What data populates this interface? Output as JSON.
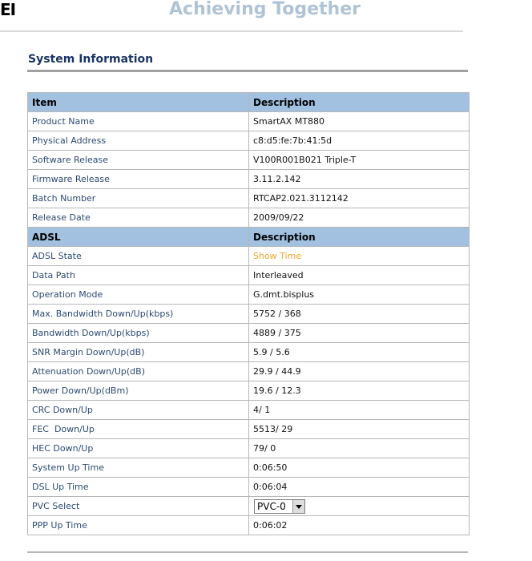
{
  "header": {
    "brand": "EI",
    "slogan": "Achieving Together"
  },
  "section": {
    "title": "System Information"
  },
  "system_table": {
    "header_item": "Item",
    "header_description": "Description",
    "rows": [
      {
        "label": "Product Name",
        "value": "SmartAX MT880"
      },
      {
        "label": "Physical Address",
        "value": "c8:d5:fe:7b:41:5d"
      },
      {
        "label": "Software Release",
        "value": "V100R001B021 Triple-T"
      },
      {
        "label": "Firmware Release",
        "value": "3.11.2.142"
      },
      {
        "label": "Batch Number",
        "value": "RTCAP2.021.3112142"
      },
      {
        "label": "Release Date",
        "value": "2009/09/22"
      }
    ]
  },
  "adsl_table": {
    "header_item": "ADSL",
    "header_description": "Description",
    "rows": [
      {
        "label": "ADSL State",
        "value": "Show Time"
      },
      {
        "label": "Data Path",
        "value": "Interleaved"
      },
      {
        "label": "Operation Mode",
        "value": "G.dmt.bisplus"
      },
      {
        "label": "Max. Bandwidth Down/Up(kbps)",
        "value": "5752 / 368"
      },
      {
        "label": "Bandwidth Down/Up(kbps)",
        "value": "4889 / 375"
      },
      {
        "label": "SNR Margin Down/Up(dB)",
        "value": "5.9 / 5.6"
      },
      {
        "label": "Attenuation Down/Up(dB)",
        "value": "29.9 / 44.9"
      },
      {
        "label": "Power Down/Up(dBm)",
        "value": "19.6 / 12.3"
      },
      {
        "label": "CRC Down/Up",
        "value": "4/ 1"
      },
      {
        "label": "FEC  Down/Up",
        "value": "5513/ 29"
      },
      {
        "label": "HEC Down/Up",
        "value": "79/ 0"
      },
      {
        "label": "System Up Time",
        "value": "0:06:50"
      },
      {
        "label": "DSL Up Time",
        "value": "0:06:04"
      },
      {
        "label": "PVC Select",
        "value": "PVC-0"
      },
      {
        "label": "PPP Up Time",
        "value": "0:06:02"
      }
    ]
  },
  "colors": {
    "header_row_bg": "#a2c0e0",
    "label_text": "#2c4a73",
    "show_time": "#f2a42a",
    "section_title": "#1a3463",
    "slogan": "#b0c3d6"
  }
}
